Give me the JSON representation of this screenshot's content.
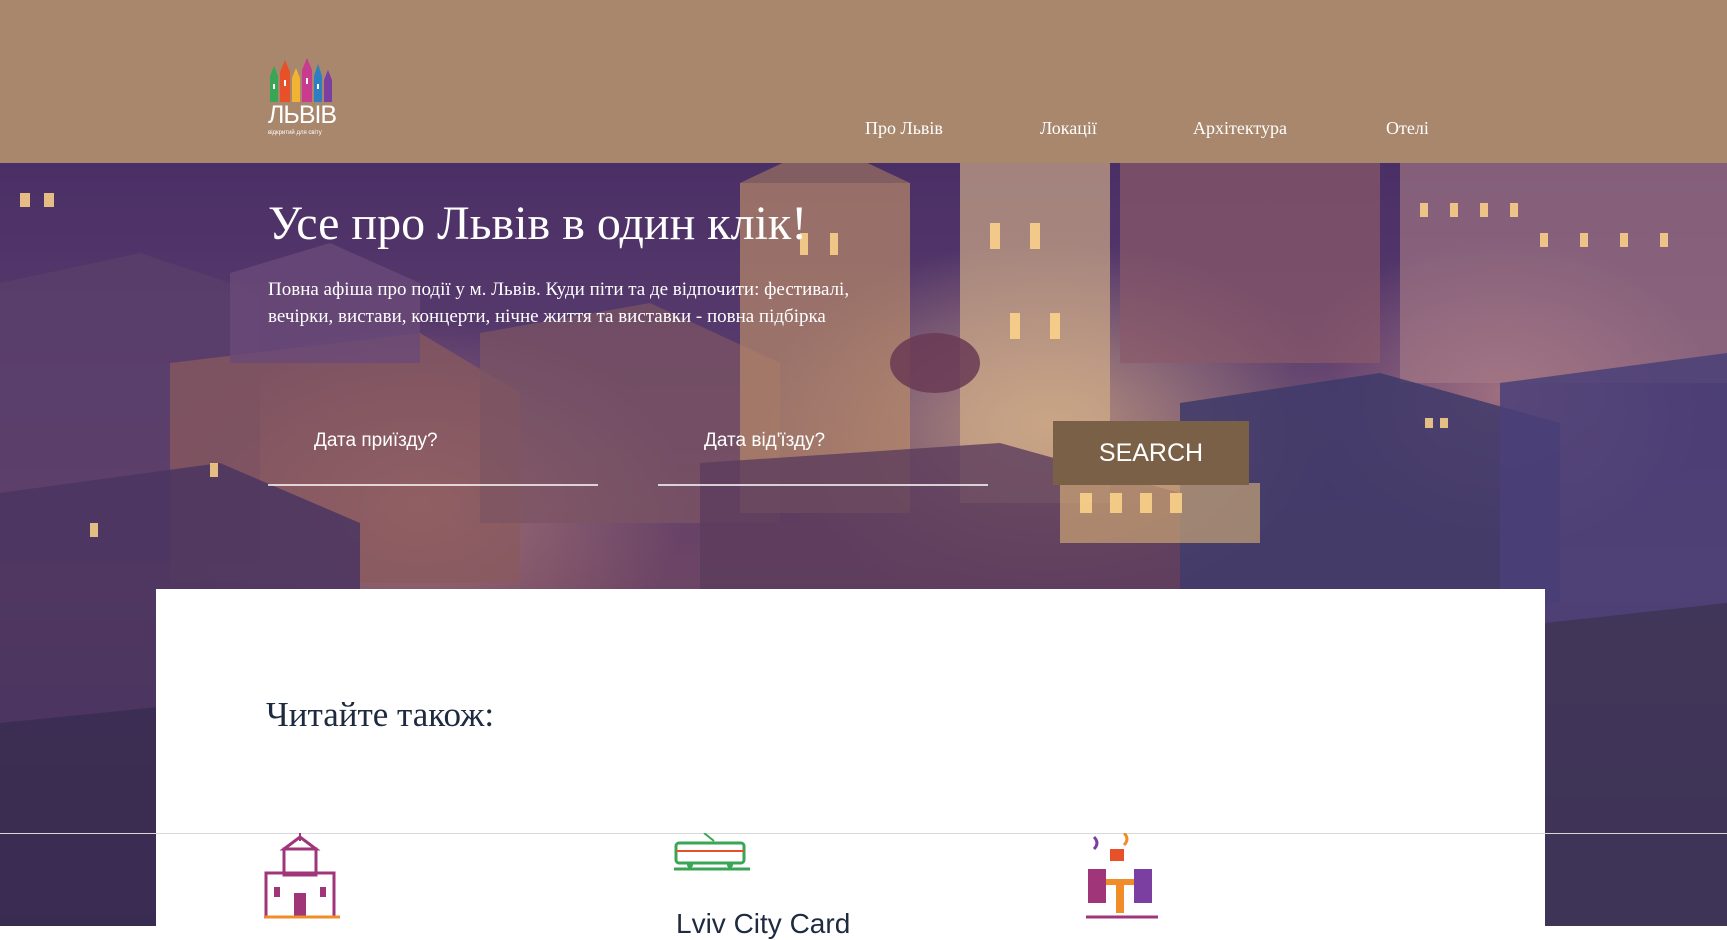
{
  "header": {
    "logo": {
      "word": "ЛЬВІВ",
      "tagline": "відкритий для світу"
    },
    "nav": [
      {
        "label": "Про Львів"
      },
      {
        "label": "Локації"
      },
      {
        "label": "Архітектура"
      },
      {
        "label": "Отелі"
      }
    ]
  },
  "hero": {
    "title": "Усе про Львів в один клік!",
    "subtitle": "Повна афіша про події у м. Львів. Куди піти та де відпочити: фестивалі, вечірки, вистави, концерти, нічне життя та виставки - повна підбірка",
    "arrival_placeholder": "Дата приїзду?",
    "departure_placeholder": "Дата від'їзду?",
    "search_label": "SEARCH"
  },
  "read_also": {
    "title": "Читайте також:",
    "cards": [
      {
        "icon": "church-icon",
        "title": ""
      },
      {
        "icon": "tram-icon",
        "title": "Lviv City Card"
      },
      {
        "icon": "cafe-icon",
        "title": ""
      }
    ]
  },
  "colors": {
    "header_bg": "#a8876c",
    "search_button": "#7a6047",
    "heading_text": "#1e2a3f"
  }
}
